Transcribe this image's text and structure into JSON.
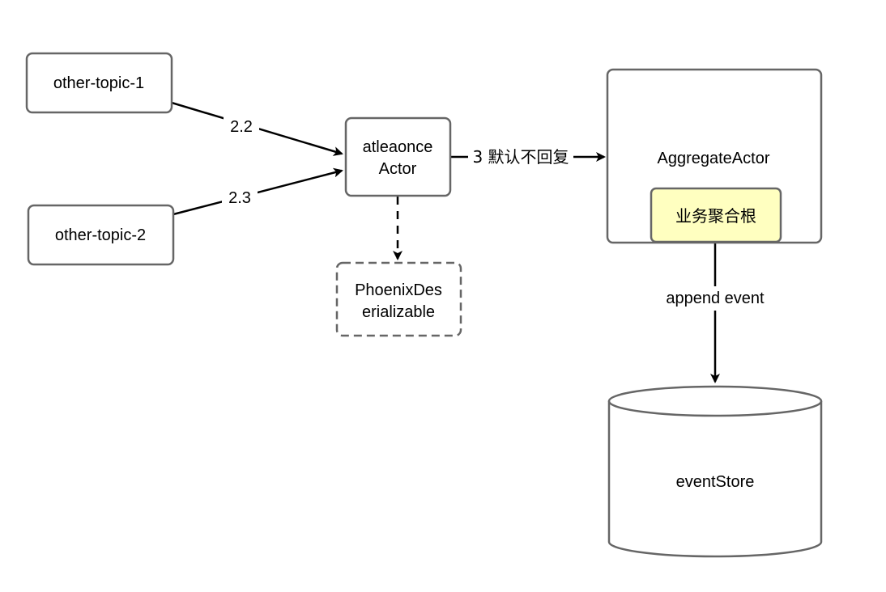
{
  "diagram": {
    "nodes": {
      "topic1": {
        "label": "other-topic-1"
      },
      "topic2": {
        "label": "other-topic-2"
      },
      "atleaonce": {
        "line1": "atleaonce",
        "line2": "Actor"
      },
      "phoenix": {
        "line1": "PhoenixDes",
        "line2": "erializable"
      },
      "aggregate": {
        "label": "AggregateActor"
      },
      "root": {
        "label": "业务聚合根"
      },
      "eventstore": {
        "label": "eventStore"
      }
    },
    "edges": {
      "topic1_to_actor": {
        "label": "2.2"
      },
      "topic2_to_actor": {
        "label": "2.3"
      },
      "actor_to_aggregate": {
        "label": "3 默认不回复"
      },
      "aggregate_to_store": {
        "label": "append event"
      }
    },
    "colors": {
      "stroke": "#666666",
      "edge": "#000000",
      "highlight_fill": "#ffffc0",
      "background": "#ffffff"
    }
  }
}
